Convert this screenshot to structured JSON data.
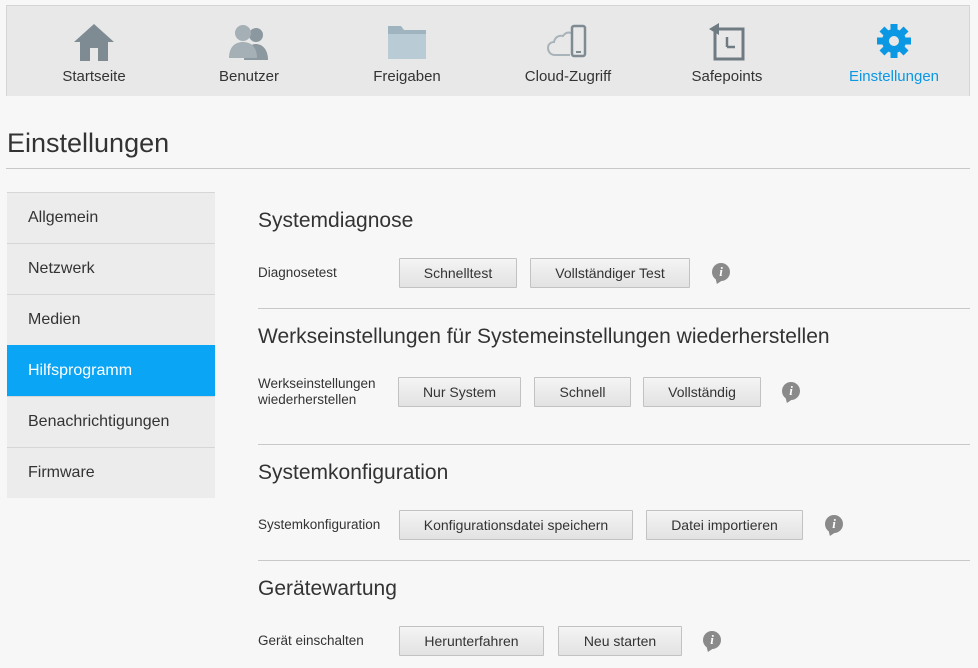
{
  "nav": {
    "items": [
      {
        "label": "Startseite",
        "icon": "home-icon"
      },
      {
        "label": "Benutzer",
        "icon": "users-icon"
      },
      {
        "label": "Freigaben",
        "icon": "folder-icon"
      },
      {
        "label": "Cloud-Zugriff",
        "icon": "cloud-device-icon"
      },
      {
        "label": "Safepoints",
        "icon": "safepoint-icon"
      },
      {
        "label": "Einstellungen",
        "icon": "gear-icon"
      }
    ],
    "active": "Einstellungen",
    "accent_color": "#0a97e3"
  },
  "page_title": "Einstellungen",
  "sidebar": {
    "items": [
      {
        "label": "Allgemein"
      },
      {
        "label": "Netzwerk"
      },
      {
        "label": "Medien"
      },
      {
        "label": "Hilfsprogramm"
      },
      {
        "label": "Benachrichtigungen"
      },
      {
        "label": "Firmware"
      }
    ],
    "active": "Hilfsprogramm",
    "active_color": "#0aa5f5"
  },
  "sections": {
    "diagnose": {
      "title": "Systemdiagnose",
      "label": "Diagnosetest",
      "buttons": [
        "Schnelltest",
        "Vollständiger Test"
      ]
    },
    "factory": {
      "title": "Werkseinstellungen für Systemeinstellungen wiederherstellen",
      "label_line1": "Werkseinstellungen",
      "label_line2": "wiederherstellen",
      "buttons": [
        "Nur System",
        "Schnell",
        "Vollständig"
      ]
    },
    "config": {
      "title": "Systemkonfiguration",
      "label": "Systemkonfiguration",
      "buttons": [
        "Konfigurationsdatei speichern",
        "Datei importieren"
      ]
    },
    "maintenance": {
      "title": "Gerätewartung",
      "label": "Gerät einschalten",
      "buttons": [
        "Herunterfahren",
        "Neu starten"
      ]
    }
  },
  "info_glyph": "i"
}
